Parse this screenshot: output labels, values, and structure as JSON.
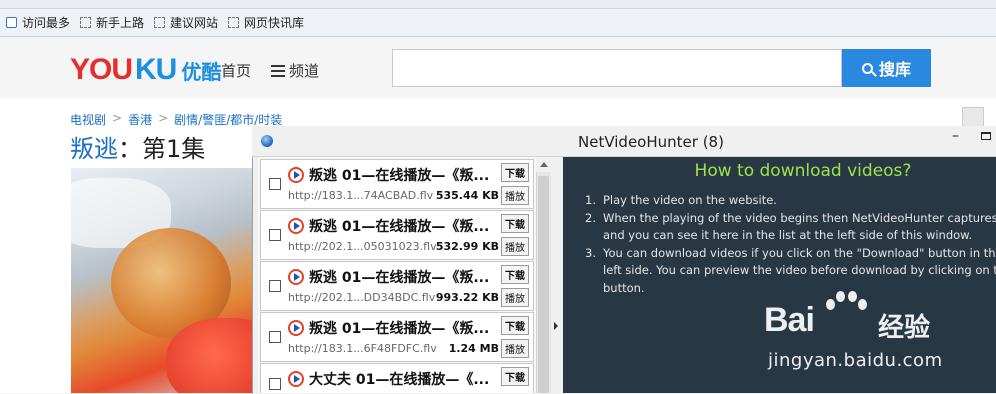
{
  "bookmarks": [
    {
      "label": "访问最多",
      "icon": "most-visited-icon"
    },
    {
      "label": "新手上路",
      "icon": "bookmark-icon"
    },
    {
      "label": "建议网站",
      "icon": "bookmark-icon"
    },
    {
      "label": "网页快讯库",
      "icon": "bookmark-icon"
    }
  ],
  "header": {
    "logo_latin_red": "YOU",
    "logo_latin_blue": "KU",
    "logo_cn": "优酷",
    "nav_home": "首页",
    "nav_channel": "频道",
    "search_placeholder": "",
    "search_button": "搜库",
    "brand_red": "#e52e2e",
    "brand_blue": "#2a88e0"
  },
  "breadcrumb": [
    "电视剧",
    "香港",
    "剧情/警匪/都市/时装"
  ],
  "breadcrumb_sep": ">",
  "title": {
    "link": "叛逃",
    "rest": "：第1集"
  },
  "nvh": {
    "window_title": "NetVideoHunter (8)",
    "min_glyph": "–",
    "download_label": "下载",
    "play_label": "播放",
    "items": [
      {
        "title": "叛逃 01—在线播放—《叛...",
        "url": "http://183.1...74ACBAD.flv",
        "size": "535.44 KB"
      },
      {
        "title": "叛逃 01—在线播放—《叛...",
        "url": "http://202.1...05031023.flv",
        "size": "532.99 KB"
      },
      {
        "title": "叛逃 01—在线播放—《叛...",
        "url": "http://202.1...DD34BDC.flv",
        "size": "993.22 KB"
      },
      {
        "title": "叛逃 01—在线播放—《叛...",
        "url": "http://183.1...6F48FDFC.flv",
        "size": "1.24 MB"
      },
      {
        "title": "大丈夫 01—在线播放—《...",
        "url": "",
        "size": ""
      }
    ],
    "info_title": "How to download videos?",
    "info_steps": [
      {
        "num": "1.",
        "text": "Play the video on the website."
      },
      {
        "num": "2.",
        "text": "When the playing of the video begins then NetVideoHunter captures the v\nand you can see it here in the list at the left side of this window."
      },
      {
        "num": "3.",
        "text": "You can download videos if you click on the \"Download\" button in the list\nleft side. You can preview the video before download by clicking on the Pl\nbutton."
      }
    ],
    "info_title_color": "#9fe34a",
    "info_bg": "#283744"
  },
  "watermark": {
    "main_left": "Bai",
    "main_right": "经验",
    "url": "jingyan.baidu.com"
  }
}
